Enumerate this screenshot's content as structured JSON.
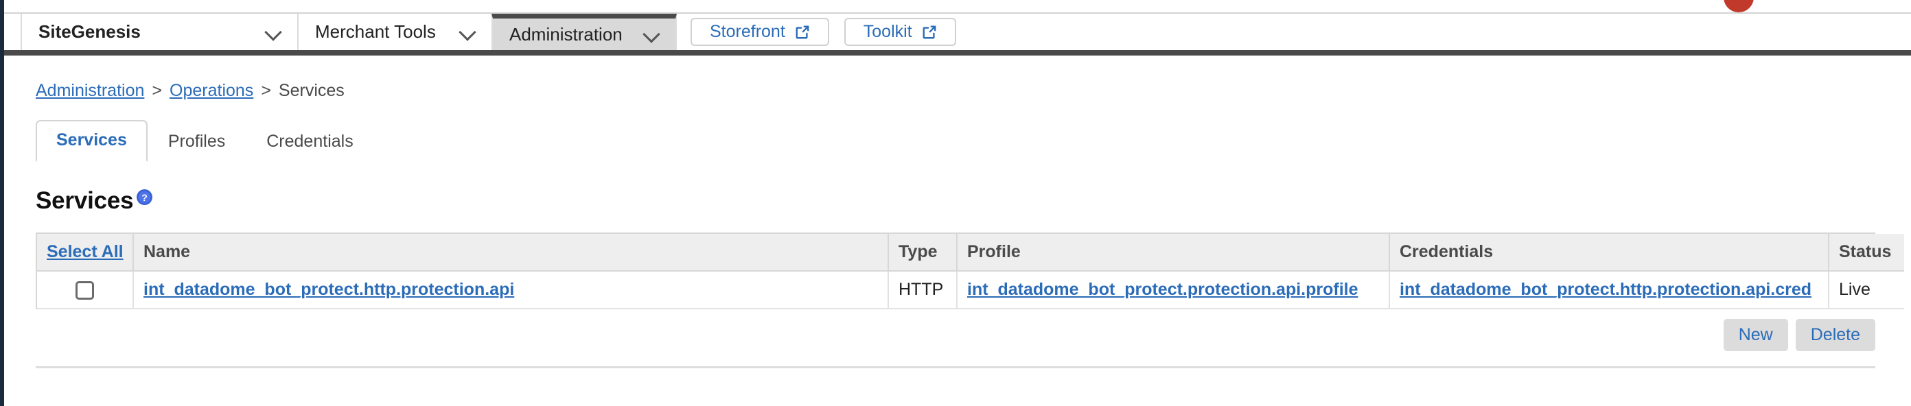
{
  "topnav": {
    "items": [
      {
        "label": "SiteGenesis",
        "icon": "chevron-down-icon",
        "active": false
      },
      {
        "label": "Merchant Tools",
        "icon": "chevron-down-icon",
        "active": false
      },
      {
        "label": "Administration",
        "icon": "chevron-down-icon",
        "active": true
      }
    ],
    "buttons": [
      {
        "label": "Storefront",
        "icon": "external-link-icon"
      },
      {
        "label": "Toolkit",
        "icon": "external-link-icon"
      }
    ]
  },
  "breadcrumb": {
    "items": [
      {
        "label": "Administration",
        "link": true
      },
      {
        "label": "Operations",
        "link": true
      },
      {
        "label": "Services",
        "link": false
      }
    ],
    "separator": ">"
  },
  "tabs": [
    {
      "label": "Services",
      "active": true
    },
    {
      "label": "Profiles",
      "active": false
    },
    {
      "label": "Credentials",
      "active": false
    }
  ],
  "page": {
    "title": "Services",
    "help_icon": "help-question-icon"
  },
  "table": {
    "headers": {
      "select_all": "Select All",
      "name": "Name",
      "type": "Type",
      "profile": "Profile",
      "credentials": "Credentials",
      "status": "Status"
    },
    "rows": [
      {
        "checked": false,
        "name": "int_datadome_bot_protect.http.protection.api",
        "type": "HTTP",
        "profile": "int_datadome_bot_protect.protection.api.profile",
        "credentials": "int_datadome_bot_protect.http.protection.api.cred",
        "status": "Live"
      }
    ]
  },
  "actions": {
    "new_label": "New",
    "delete_label": "Delete"
  },
  "colors": {
    "link": "#2b6cb8",
    "active_tab_bg": "#d9d9d9",
    "header_bg": "#eeeeee",
    "dark_bar": "#4a4a4a",
    "left_edge": "#1b2a3d",
    "blob_red": "#c0392b"
  }
}
